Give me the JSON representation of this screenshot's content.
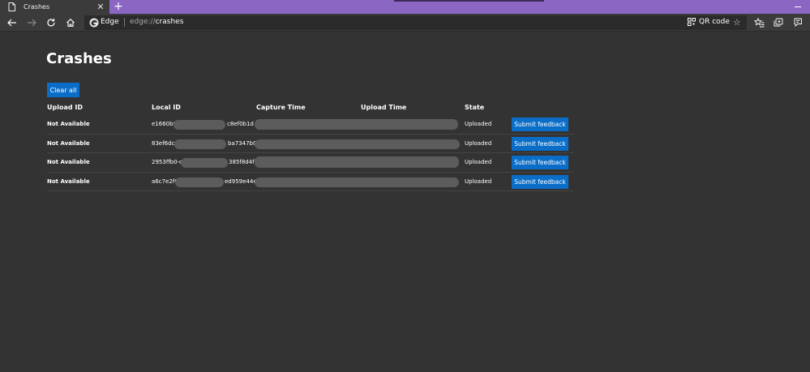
{
  "tab": {
    "title": "Crashes",
    "close_glyph": "✕",
    "new_glyph": "+"
  },
  "toolbar": {
    "site_label": "Edge",
    "url_scheme": "edge://",
    "url_path": "crashes",
    "qr_label": "QR code",
    "star_glyph": "☆"
  },
  "page": {
    "title": "Crashes",
    "clear_all_label": "Clear all",
    "columns": [
      "Upload ID",
      "Local ID",
      "Capture Time",
      "Upload Time",
      "State"
    ],
    "submit_label": "Submit feedback",
    "rows": [
      {
        "upload_id": "Not Available",
        "local_id_start": "e1660b81",
        "local_id_end": "c8ef0b1d",
        "state": "Uploaded"
      },
      {
        "upload_id": "Not Available",
        "local_id_start": "83ef6dc8",
        "local_id_end": "ba7347b0",
        "state": "Uploaded"
      },
      {
        "upload_id": "Not Available",
        "local_id_start": "2953ffb0-c",
        "local_id_end": "385f8d4f1",
        "state": "Uploaded"
      },
      {
        "upload_id": "Not Available",
        "local_id_start": "a6c7e2f0-",
        "local_id_end": "ed959e44e9",
        "state": "Uploaded"
      }
    ]
  },
  "colors": {
    "accent": "#0a6ec9",
    "titlebar": "#8b66c2",
    "background": "#333333"
  }
}
